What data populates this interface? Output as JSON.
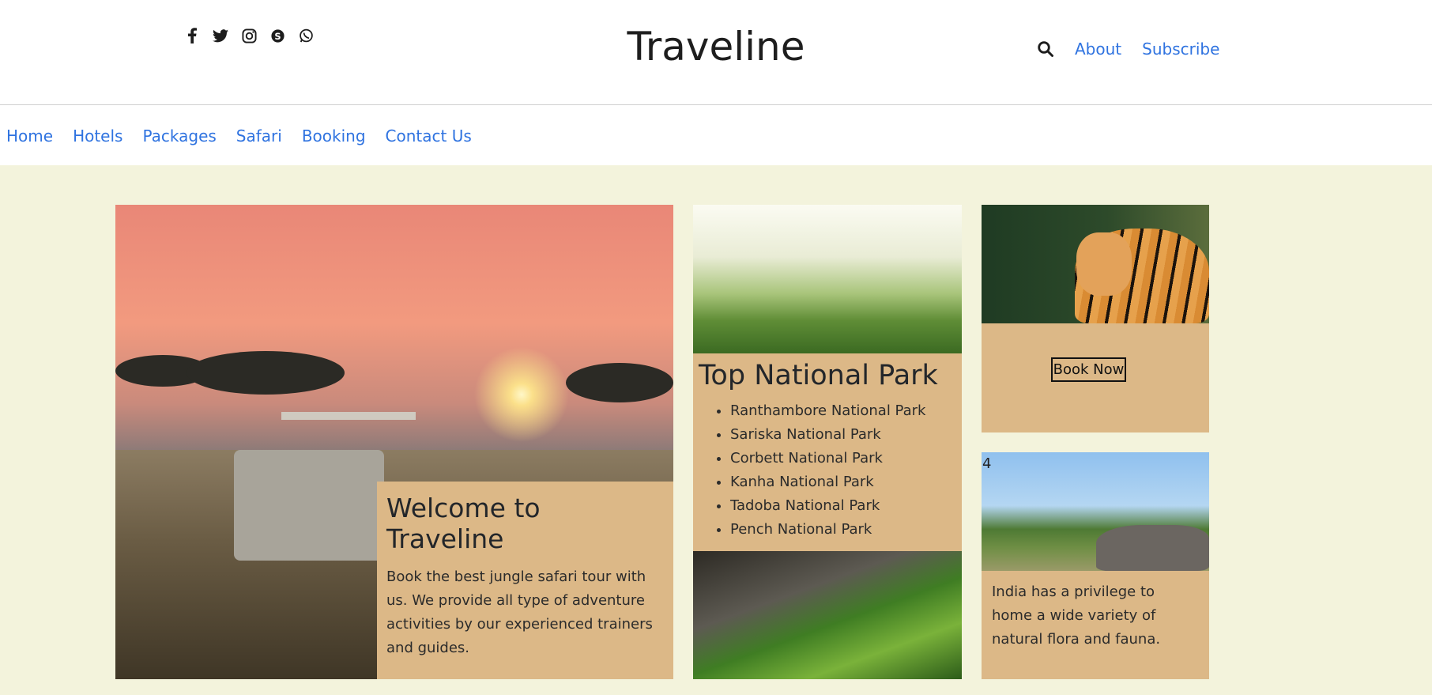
{
  "header": {
    "brand": "Traveline",
    "social_icons": [
      "facebook-icon",
      "twitter-icon",
      "instagram-icon",
      "skype-icon",
      "whatsapp-icon"
    ],
    "right_links": [
      "About",
      "Subscribe"
    ],
    "search_icon": "search-icon"
  },
  "nav": {
    "items": [
      "Home",
      "Hotels",
      "Packages",
      "Safari",
      "Booking",
      "Contact Us"
    ]
  },
  "hero": {
    "title": "Welcome to Traveline",
    "text": "Book the best jungle safari tour with us. We provide all type of adventure activities by our experienced trainers and guides."
  },
  "parks": {
    "title": "Top National Park",
    "items": [
      "Ranthambore National Park",
      "Sariska National Park",
      "Corbett National Park",
      "Kanha National Park",
      "Tadoba National Park",
      "Pench National Park"
    ]
  },
  "booking": {
    "button_label": "Book Now"
  },
  "wildlife": {
    "badge": "4",
    "text": "India has a privilege to home a wide variety of natural flora and fauna."
  },
  "colors": {
    "link": "#2f73e0",
    "card": "#dcb887",
    "background": "#f3f3dc"
  }
}
